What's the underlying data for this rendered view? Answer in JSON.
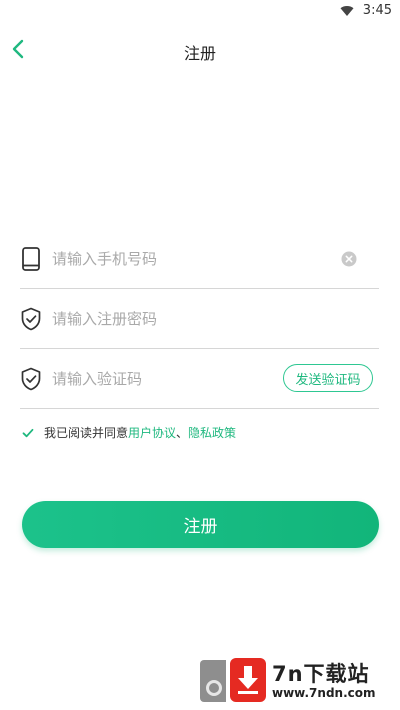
{
  "status_bar": {
    "time": "3:45"
  },
  "header": {
    "title": "注册"
  },
  "form": {
    "phone_placeholder": "请输入手机号码",
    "password_placeholder": "请输入注册密码",
    "code_placeholder": "请输入验证码",
    "send_code_label": "发送验证码"
  },
  "agreement": {
    "checked": true,
    "prefix": "我已阅读并同意",
    "user_agreement": "用户协议",
    "separator": "、",
    "privacy_policy": "隐私政策"
  },
  "register_label": "注册",
  "watermark": {
    "title": "7n下载站",
    "url": "www.7ndn.com"
  },
  "colors": {
    "accent": "#1fb87f",
    "divider": "#d6d6d6",
    "watermark_red": "#e52a22"
  },
  "icons": [
    "wifi-icon",
    "back-arrow-icon",
    "phone-icon",
    "shield-check-icon",
    "clear-icon",
    "checkbox-checked-icon",
    "download-arrow-icon"
  ]
}
